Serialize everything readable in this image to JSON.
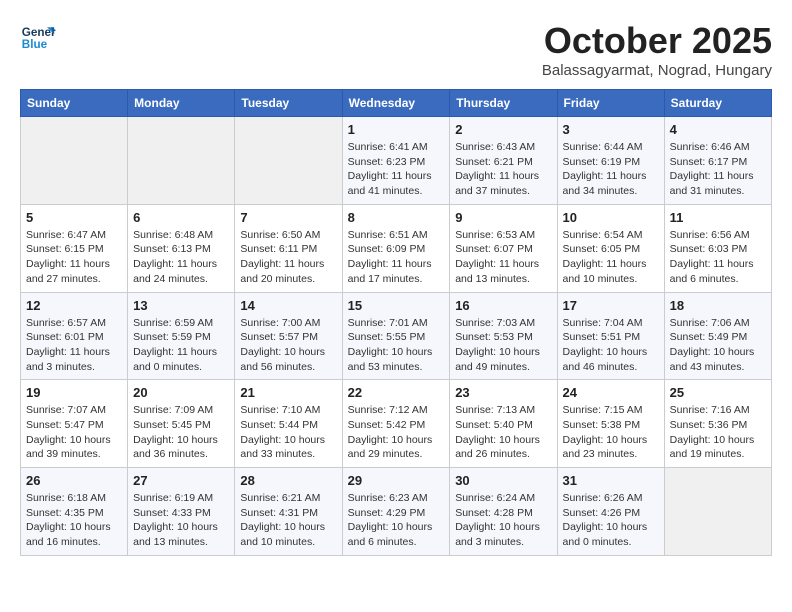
{
  "header": {
    "logo_line1": "General",
    "logo_line2": "Blue",
    "month": "October 2025",
    "location": "Balassagyarmat, Nograd, Hungary"
  },
  "weekdays": [
    "Sunday",
    "Monday",
    "Tuesday",
    "Wednesday",
    "Thursday",
    "Friday",
    "Saturday"
  ],
  "weeks": [
    [
      {
        "day": "",
        "info": ""
      },
      {
        "day": "",
        "info": ""
      },
      {
        "day": "",
        "info": ""
      },
      {
        "day": "1",
        "info": "Sunrise: 6:41 AM\nSunset: 6:23 PM\nDaylight: 11 hours\nand 41 minutes."
      },
      {
        "day": "2",
        "info": "Sunrise: 6:43 AM\nSunset: 6:21 PM\nDaylight: 11 hours\nand 37 minutes."
      },
      {
        "day": "3",
        "info": "Sunrise: 6:44 AM\nSunset: 6:19 PM\nDaylight: 11 hours\nand 34 minutes."
      },
      {
        "day": "4",
        "info": "Sunrise: 6:46 AM\nSunset: 6:17 PM\nDaylight: 11 hours\nand 31 minutes."
      }
    ],
    [
      {
        "day": "5",
        "info": "Sunrise: 6:47 AM\nSunset: 6:15 PM\nDaylight: 11 hours\nand 27 minutes."
      },
      {
        "day": "6",
        "info": "Sunrise: 6:48 AM\nSunset: 6:13 PM\nDaylight: 11 hours\nand 24 minutes."
      },
      {
        "day": "7",
        "info": "Sunrise: 6:50 AM\nSunset: 6:11 PM\nDaylight: 11 hours\nand 20 minutes."
      },
      {
        "day": "8",
        "info": "Sunrise: 6:51 AM\nSunset: 6:09 PM\nDaylight: 11 hours\nand 17 minutes."
      },
      {
        "day": "9",
        "info": "Sunrise: 6:53 AM\nSunset: 6:07 PM\nDaylight: 11 hours\nand 13 minutes."
      },
      {
        "day": "10",
        "info": "Sunrise: 6:54 AM\nSunset: 6:05 PM\nDaylight: 11 hours\nand 10 minutes."
      },
      {
        "day": "11",
        "info": "Sunrise: 6:56 AM\nSunset: 6:03 PM\nDaylight: 11 hours\nand 6 minutes."
      }
    ],
    [
      {
        "day": "12",
        "info": "Sunrise: 6:57 AM\nSunset: 6:01 PM\nDaylight: 11 hours\nand 3 minutes."
      },
      {
        "day": "13",
        "info": "Sunrise: 6:59 AM\nSunset: 5:59 PM\nDaylight: 11 hours\nand 0 minutes."
      },
      {
        "day": "14",
        "info": "Sunrise: 7:00 AM\nSunset: 5:57 PM\nDaylight: 10 hours\nand 56 minutes."
      },
      {
        "day": "15",
        "info": "Sunrise: 7:01 AM\nSunset: 5:55 PM\nDaylight: 10 hours\nand 53 minutes."
      },
      {
        "day": "16",
        "info": "Sunrise: 7:03 AM\nSunset: 5:53 PM\nDaylight: 10 hours\nand 49 minutes."
      },
      {
        "day": "17",
        "info": "Sunrise: 7:04 AM\nSunset: 5:51 PM\nDaylight: 10 hours\nand 46 minutes."
      },
      {
        "day": "18",
        "info": "Sunrise: 7:06 AM\nSunset: 5:49 PM\nDaylight: 10 hours\nand 43 minutes."
      }
    ],
    [
      {
        "day": "19",
        "info": "Sunrise: 7:07 AM\nSunset: 5:47 PM\nDaylight: 10 hours\nand 39 minutes."
      },
      {
        "day": "20",
        "info": "Sunrise: 7:09 AM\nSunset: 5:45 PM\nDaylight: 10 hours\nand 36 minutes."
      },
      {
        "day": "21",
        "info": "Sunrise: 7:10 AM\nSunset: 5:44 PM\nDaylight: 10 hours\nand 33 minutes."
      },
      {
        "day": "22",
        "info": "Sunrise: 7:12 AM\nSunset: 5:42 PM\nDaylight: 10 hours\nand 29 minutes."
      },
      {
        "day": "23",
        "info": "Sunrise: 7:13 AM\nSunset: 5:40 PM\nDaylight: 10 hours\nand 26 minutes."
      },
      {
        "day": "24",
        "info": "Sunrise: 7:15 AM\nSunset: 5:38 PM\nDaylight: 10 hours\nand 23 minutes."
      },
      {
        "day": "25",
        "info": "Sunrise: 7:16 AM\nSunset: 5:36 PM\nDaylight: 10 hours\nand 19 minutes."
      }
    ],
    [
      {
        "day": "26",
        "info": "Sunrise: 6:18 AM\nSunset: 4:35 PM\nDaylight: 10 hours\nand 16 minutes."
      },
      {
        "day": "27",
        "info": "Sunrise: 6:19 AM\nSunset: 4:33 PM\nDaylight: 10 hours\nand 13 minutes."
      },
      {
        "day": "28",
        "info": "Sunrise: 6:21 AM\nSunset: 4:31 PM\nDaylight: 10 hours\nand 10 minutes."
      },
      {
        "day": "29",
        "info": "Sunrise: 6:23 AM\nSunset: 4:29 PM\nDaylight: 10 hours\nand 6 minutes."
      },
      {
        "day": "30",
        "info": "Sunrise: 6:24 AM\nSunset: 4:28 PM\nDaylight: 10 hours\nand 3 minutes."
      },
      {
        "day": "31",
        "info": "Sunrise: 6:26 AM\nSunset: 4:26 PM\nDaylight: 10 hours\nand 0 minutes."
      },
      {
        "day": "",
        "info": ""
      }
    ]
  ]
}
